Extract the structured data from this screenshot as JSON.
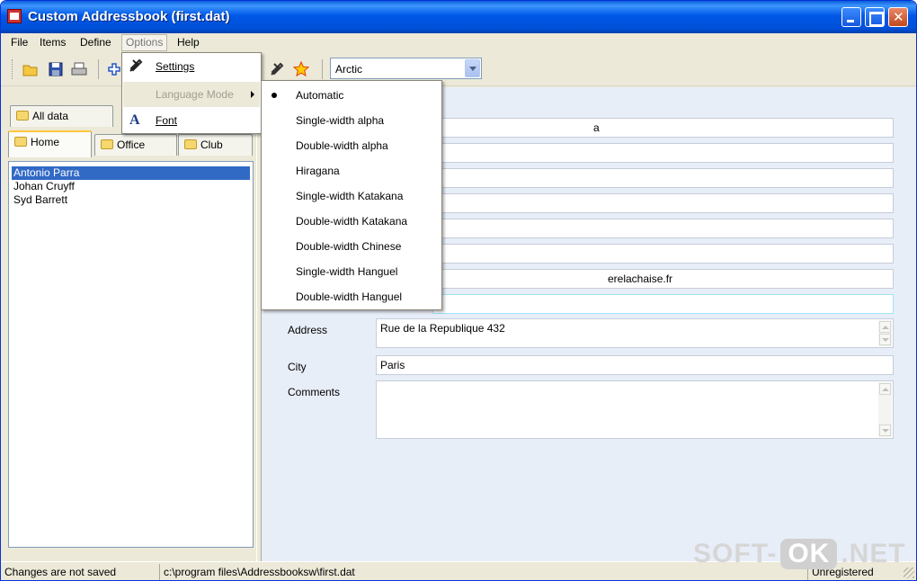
{
  "window": {
    "title": "Custom Addressbook (first.dat)"
  },
  "menubar": [
    "File",
    "Items",
    "Define",
    "Options",
    "Help"
  ],
  "toolbar": {
    "theme_value": "Arctic"
  },
  "tabs_row1": [
    "All data"
  ],
  "tabs_row2": [
    "Home",
    "Office",
    "Club"
  ],
  "contacts": [
    "Antonio Parra",
    "Johan Cruyff",
    "Syd Barrett"
  ],
  "form": {
    "visible_fragments": {
      "row1": "a",
      "row7": "erelachaise.fr"
    },
    "address_label": "Address",
    "address_value": "Rue de la Republique 432",
    "city_label": "City",
    "city_value": "Paris",
    "comments_label": "Comments",
    "comments_value": ""
  },
  "options_menu": {
    "settings": "Settings",
    "language_mode": "Language Mode",
    "font": "Font"
  },
  "language_submenu": {
    "items": [
      "Automatic",
      "Single-width alpha",
      "Double-width alpha",
      "Hiragana",
      "Single-width Katakana",
      "Double-width Katakana",
      "Double-width Chinese",
      "Single-width Hanguel",
      "Double-width Hanguel"
    ],
    "selected": "Automatic"
  },
  "status": {
    "save_state": "Changes are not saved",
    "path": "c:\\program files\\Addressbooksw\\first.dat",
    "registration": "Unregistered"
  },
  "watermark": {
    "left": "SOFT-",
    "box": "OK",
    "right": ".NET"
  }
}
